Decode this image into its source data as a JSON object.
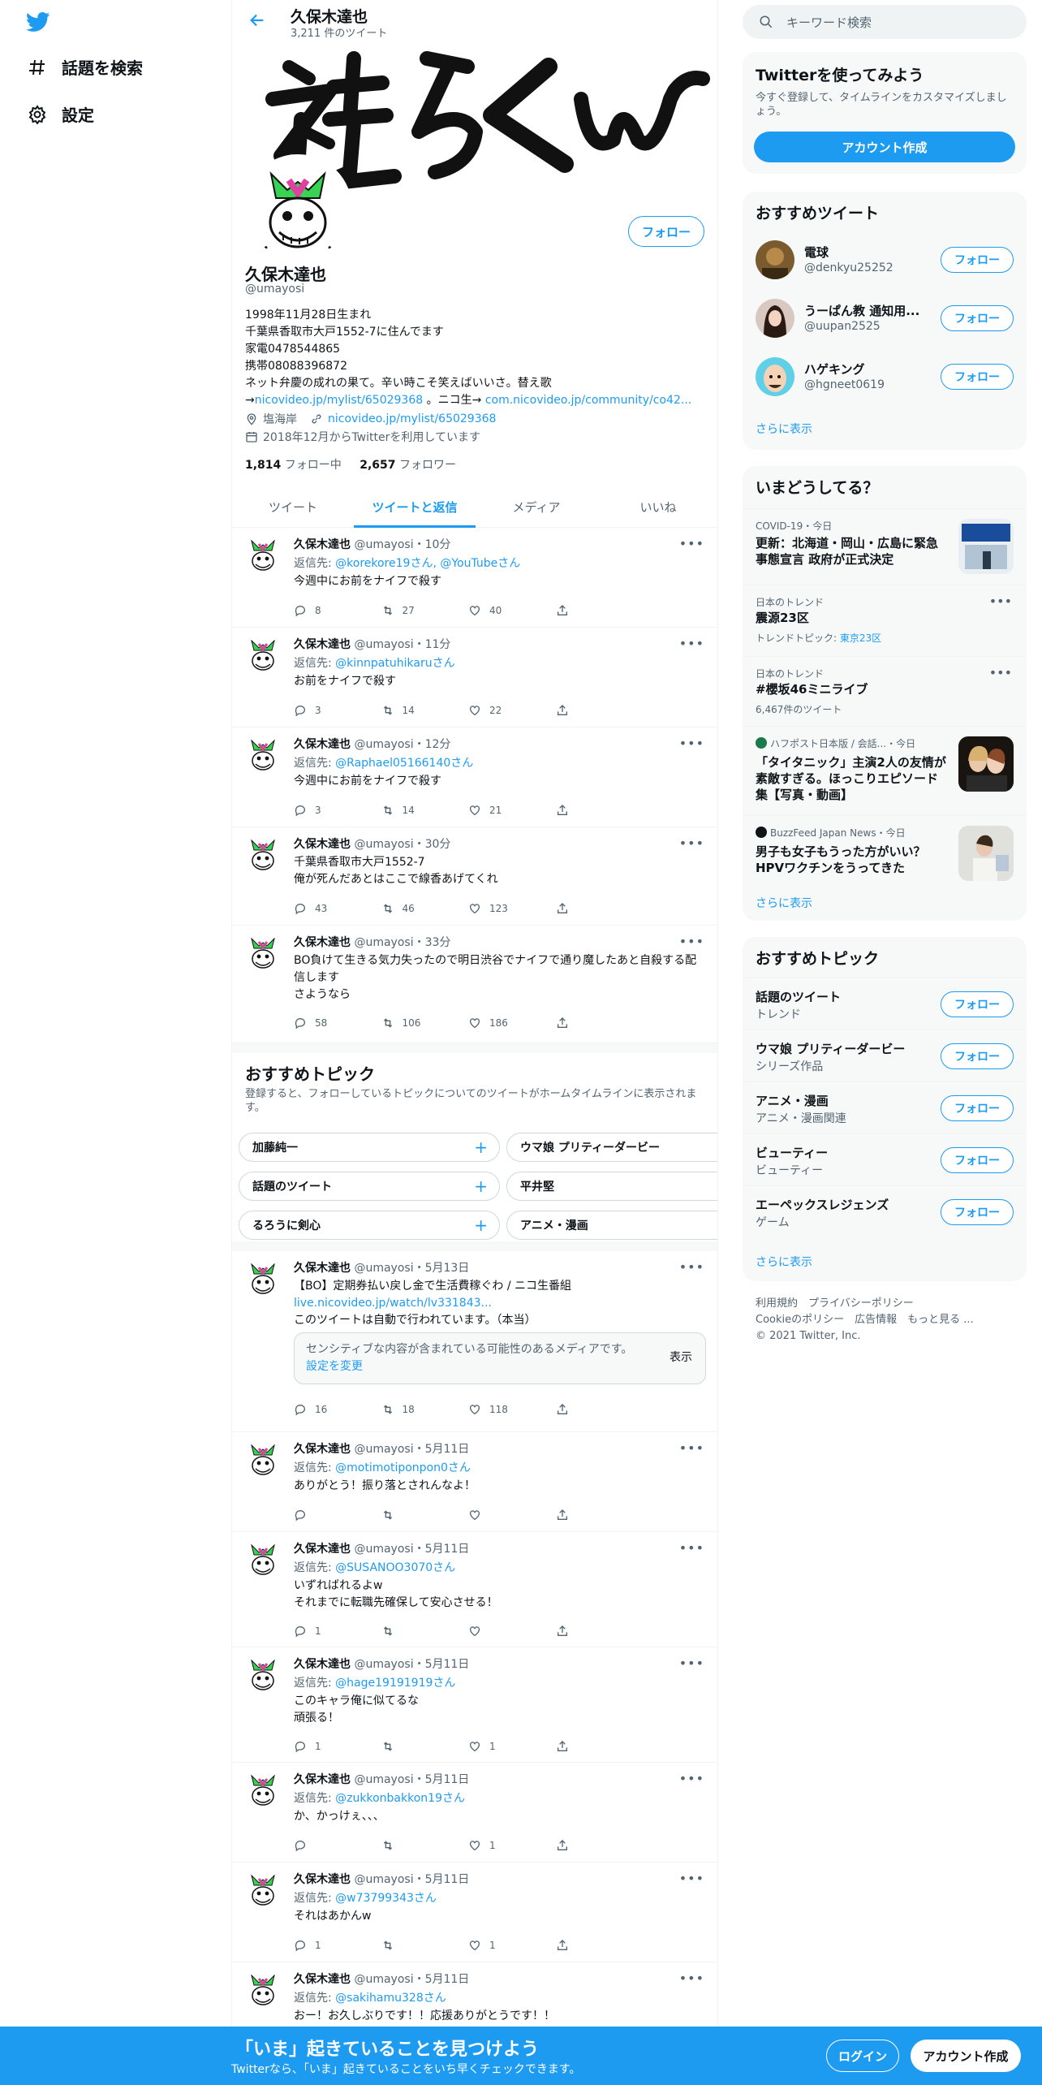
{
  "nav": {
    "explore_label": "話題を検索",
    "settings_label": "設定"
  },
  "header": {
    "name": "久保木達也",
    "tweet_count": "3,211 件のツイート"
  },
  "profile": {
    "follow_label": "フォロー",
    "name": "久保木達也",
    "handle": "@umayosi",
    "bio_lines": [
      "1998年11月28日生まれ",
      "千葉県香取市大戸1552-7に住んでます",
      "家電0478544865",
      "携帯08088396872",
      "ネット弁慶の成れの果て。辛い時こそ笑えばいいさ。替え歌"
    ],
    "bio_tail_prefix": "→",
    "bio_link1": "nicovideo.jp/mylist/65029368",
    "bio_tail_mid": " 。ニコ生→ ",
    "bio_link2": "com.nicovideo.jp/community/co42...",
    "location": "塩海岸",
    "website": "nicovideo.jp/mylist/65029368",
    "joined": "2018年12月からTwitterを利用しています",
    "following_count": "1,814",
    "following_label": "フォロー中",
    "followers_count": "2,657",
    "followers_label": "フォロワー"
  },
  "tabs": [
    "ツイート",
    "ツイートと返信",
    "メディア",
    "いいね"
  ],
  "reply_prefix": "返信先: ",
  "tweets": [
    {
      "name": "久保木達也",
      "meta": "@umayosi・10分",
      "reply_to": "@korekore19さん, @YouTubeさん",
      "text": "今週中にお前をナイフで殺す",
      "replies": "8",
      "retweets": "27",
      "likes": "40"
    },
    {
      "name": "久保木達也",
      "meta": "@umayosi・11分",
      "reply_to": "@kinnpatuhikaruさん",
      "text": "お前をナイフで殺す",
      "replies": "3",
      "retweets": "14",
      "likes": "22"
    },
    {
      "name": "久保木達也",
      "meta": "@umayosi・12分",
      "reply_to": "@Raphael05166140さん",
      "text": "今週中にお前をナイフで殺す",
      "replies": "3",
      "retweets": "14",
      "likes": "21"
    },
    {
      "name": "久保木達也",
      "meta": "@umayosi・30分",
      "reply_to": "",
      "text": "千葉県香取市大戸1552-7\n俺が死んだあとはここで線香あげてくれ",
      "replies": "43",
      "retweets": "46",
      "likes": "123"
    },
    {
      "name": "久保木達也",
      "meta": "@umayosi・33分",
      "reply_to": "",
      "text": "BO負けて生きる気力失ったので明日渋谷でナイフで通り魔したあと自殺する配信します\nさようなら",
      "replies": "58",
      "retweets": "106",
      "likes": "186"
    }
  ],
  "topics_section": {
    "title": "おすすめトピック",
    "subtitle": "登録すると、フォローしているトピックについてのツイートがホームタイムラインに表示されます。",
    "pills": [
      "加藤純一",
      "ウマ娘 プリティーダービー",
      "話題のツイート",
      "平井堅",
      "るろうに剣心",
      "アニメ・漫画"
    ]
  },
  "tweets2": [
    {
      "name": "久保木達也",
      "meta": "@umayosi・5月13日",
      "text1": "【BO】定期券払い戻し金で生活費稼ぐわ / ニコ生番組",
      "link": "live.nicovideo.jp/watch/lv331843...",
      "text2": "このツイートは自動で行われています。（本当）",
      "sensitive_text": "センシティブな内容が含まれている可能性のあるメディアです。",
      "sensitive_link": "設定を変更",
      "show_label": "表示",
      "replies": "16",
      "retweets": "18",
      "likes": "118"
    },
    {
      "name": "久保木達也",
      "meta": "@umayosi・5月11日",
      "reply_to": "@motimotiponpon0さん",
      "text": "ありがとう！振り落とされんなよ！",
      "replies": "",
      "retweets": "",
      "likes": ""
    },
    {
      "name": "久保木達也",
      "meta": "@umayosi・5月11日",
      "reply_to": "@SUSANOO3070さん",
      "text": "いずればれるよw\nそれまでに転職先確保して安心させる！",
      "replies": "1",
      "retweets": "",
      "likes": ""
    },
    {
      "name": "久保木達也",
      "meta": "@umayosi・5月11日",
      "reply_to": "@hage19191919さん",
      "text": "このキャラ俺に似てるな\n頑張る！",
      "replies": "1",
      "retweets": "",
      "likes": "1"
    },
    {
      "name": "久保木達也",
      "meta": "@umayosi・5月11日",
      "reply_to": "@zukkonbakkon19さん",
      "text": "か、かっけぇ、、、",
      "replies": "",
      "retweets": "",
      "likes": "1"
    },
    {
      "name": "久保木達也",
      "meta": "@umayosi・5月11日",
      "reply_to": "@w73799343さん",
      "text": "それはあかんw",
      "replies": "1",
      "retweets": "",
      "likes": "1"
    },
    {
      "name": "久保木達也",
      "meta": "@umayosi・5月11日",
      "reply_to": "@sakihamu328さん",
      "text": "おー！お久しぶりです！！応援ありがとうです！！",
      "replies": "",
      "retweets": "",
      "likes": ""
    }
  ],
  "sidebar": {
    "search_placeholder": "キーワード検索",
    "signup_card": {
      "title": "Twitterを使ってみよう",
      "subtitle": "今すぐ登録して、タイムラインをカスタマイズしましょう。",
      "button": "アカウント作成"
    },
    "recommend": {
      "title": "おすすめツイート",
      "users": [
        {
          "name": "電球",
          "handle": "@denkyu25252"
        },
        {
          "name": "うーぱん教 通知用...",
          "handle": "@uupan2525"
        },
        {
          "name": "ハゲキング",
          "handle": "@hgneet0619"
        }
      ],
      "follow_label": "フォロー",
      "more": "さらに表示"
    },
    "trends": {
      "title": "いまどうしてる？",
      "items": [
        {
          "meta": "COVID-19・今日",
          "title": "更新：北海道・岡山・広島に緊急事態宣言 政府が正式決定",
          "sub": ""
        },
        {
          "meta": "日本のトレンド",
          "title": "震源23区",
          "sub_prefix": "トレンドトピック: ",
          "sub_link": "東京23区"
        },
        {
          "meta": "日本のトレンド",
          "title": "#櫻坂46ミニライブ",
          "sub": "6,467件のツイート"
        },
        {
          "meta": "ハフポスト日本版 / 会話...・今日",
          "title": "「タイタニック」主演2人の友情が素敵すぎる。ほっこりエピソード集【写真・動画】"
        },
        {
          "meta": "BuzzFeed Japan News・今日",
          "title": "男子も女子もうった方がいい？ HPVワクチンをうってきた"
        }
      ],
      "more": "さらに表示"
    },
    "topics": {
      "title": "おすすめトピック",
      "items": [
        {
          "name": "話題のツイート",
          "category": "トレンド"
        },
        {
          "name": "ウマ娘 プリティーダービー",
          "category": "シリーズ作品"
        },
        {
          "name": "アニメ・漫画",
          "category": "アニメ・漫画関連"
        },
        {
          "name": "ビューティー",
          "category": "ビューティー"
        },
        {
          "name": "エーペックスレジェンズ",
          "category": "ゲーム"
        }
      ],
      "follow_label": "フォロー",
      "more": "さらに表示"
    },
    "footer": {
      "line1": "利用規約　プライバシーポリシー",
      "line2": "Cookieのポリシー　広告情報　もっと見る ...",
      "line3": "© 2021 Twitter, Inc."
    }
  },
  "bottom": {
    "title": "「いま」起きていることを見つけよう",
    "subtitle": "Twitterなら、「いま」起きていることをいち早くチェックできます。",
    "login": "ログイン",
    "signup": "アカウント作成"
  },
  "colors": {
    "accent": "#1d9bf0",
    "text": "#0f1419",
    "muted": "#536471"
  }
}
